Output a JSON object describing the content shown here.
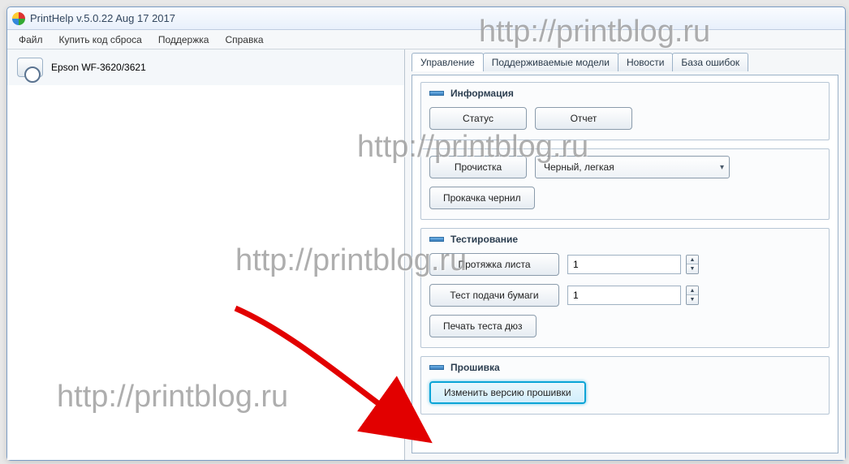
{
  "window": {
    "title": "PrintHelp v.5.0.22 Aug 17 2017"
  },
  "menu": {
    "file": "Файл",
    "buy": "Купить код сброса",
    "support": "Поддержка",
    "help": "Справка"
  },
  "printer": {
    "name": "Epson WF-3620/3621"
  },
  "tabs": {
    "manage": "Управление",
    "models": "Поддерживаемые модели",
    "news": "Новости",
    "errors": "База ошибок"
  },
  "groups": {
    "info": {
      "title": "Информация",
      "status_btn": "Статус",
      "report_btn": "Отчет"
    },
    "clean": {
      "clean_btn": "Прочистка",
      "select_value": "Черный, легкая",
      "inkpump_btn": "Прокачка чернил"
    },
    "test": {
      "title": "Тестирование",
      "sheet_btn": "Протяжка листа",
      "sheet_value": "1",
      "feed_btn": "Тест подачи бумаги",
      "feed_value": "1",
      "nozzle_btn": "Печать теста дюз"
    },
    "fw": {
      "title": "Прошивка",
      "change_btn": "Изменить версию прошивки"
    }
  },
  "watermark": "http://printblog.ru"
}
